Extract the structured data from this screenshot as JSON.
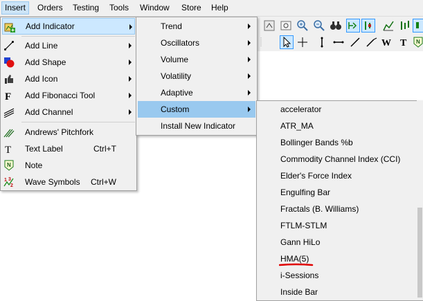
{
  "menubar": {
    "items": [
      {
        "label": "Insert"
      },
      {
        "label": "Orders"
      },
      {
        "label": "Testing"
      },
      {
        "label": "Tools"
      },
      {
        "label": "Window"
      },
      {
        "label": "Store"
      },
      {
        "label": "Help"
      }
    ]
  },
  "insert_menu": {
    "items": [
      {
        "label": "Add Indicator",
        "icon": "add-indicator-icon"
      },
      {
        "label": "Add Line",
        "icon": "line-icon"
      },
      {
        "label": "Add Shape",
        "icon": "shape-icon"
      },
      {
        "label": "Add Icon",
        "icon": "thumb-icon"
      },
      {
        "label": "Add Fibonacci Tool",
        "icon": "fibonacci-icon"
      },
      {
        "label": "Add Channel",
        "icon": "channel-icon"
      },
      {
        "label": "Andrews' Pitchfork",
        "icon": "pitchfork-icon"
      },
      {
        "label": "Text Label",
        "shortcut": "Ctrl+T",
        "icon": "text-icon"
      },
      {
        "label": "Note",
        "icon": "note-icon"
      },
      {
        "label": "Wave Symbols",
        "shortcut": "Ctrl+W",
        "icon": "wave-icon"
      }
    ]
  },
  "indicator_submenu": {
    "items": [
      {
        "label": "Trend"
      },
      {
        "label": "Oscillators"
      },
      {
        "label": "Volume"
      },
      {
        "label": "Volatility"
      },
      {
        "label": "Adaptive"
      },
      {
        "label": "Custom"
      },
      {
        "label": "Install New Indicator"
      }
    ]
  },
  "custom_submenu": {
    "items": [
      {
        "label": "accelerator"
      },
      {
        "label": "ATR_MA"
      },
      {
        "label": "Bollinger Bands %b"
      },
      {
        "label": "Commodity Channel Index (CCI)"
      },
      {
        "label": "Elder's Force Index"
      },
      {
        "label": "Engulfing Bar"
      },
      {
        "label": "Fractals (B. Williams)"
      },
      {
        "label": "FTLM-STLM"
      },
      {
        "label": "Gann HiLo"
      },
      {
        "label": "HMA(5)"
      },
      {
        "label": "i-Sessions"
      },
      {
        "label": "Inside Bar"
      }
    ]
  },
  "colors": {
    "highlight": "#99c9ef",
    "menu_bg": "#f0f0f0",
    "underline": "#e00000"
  }
}
